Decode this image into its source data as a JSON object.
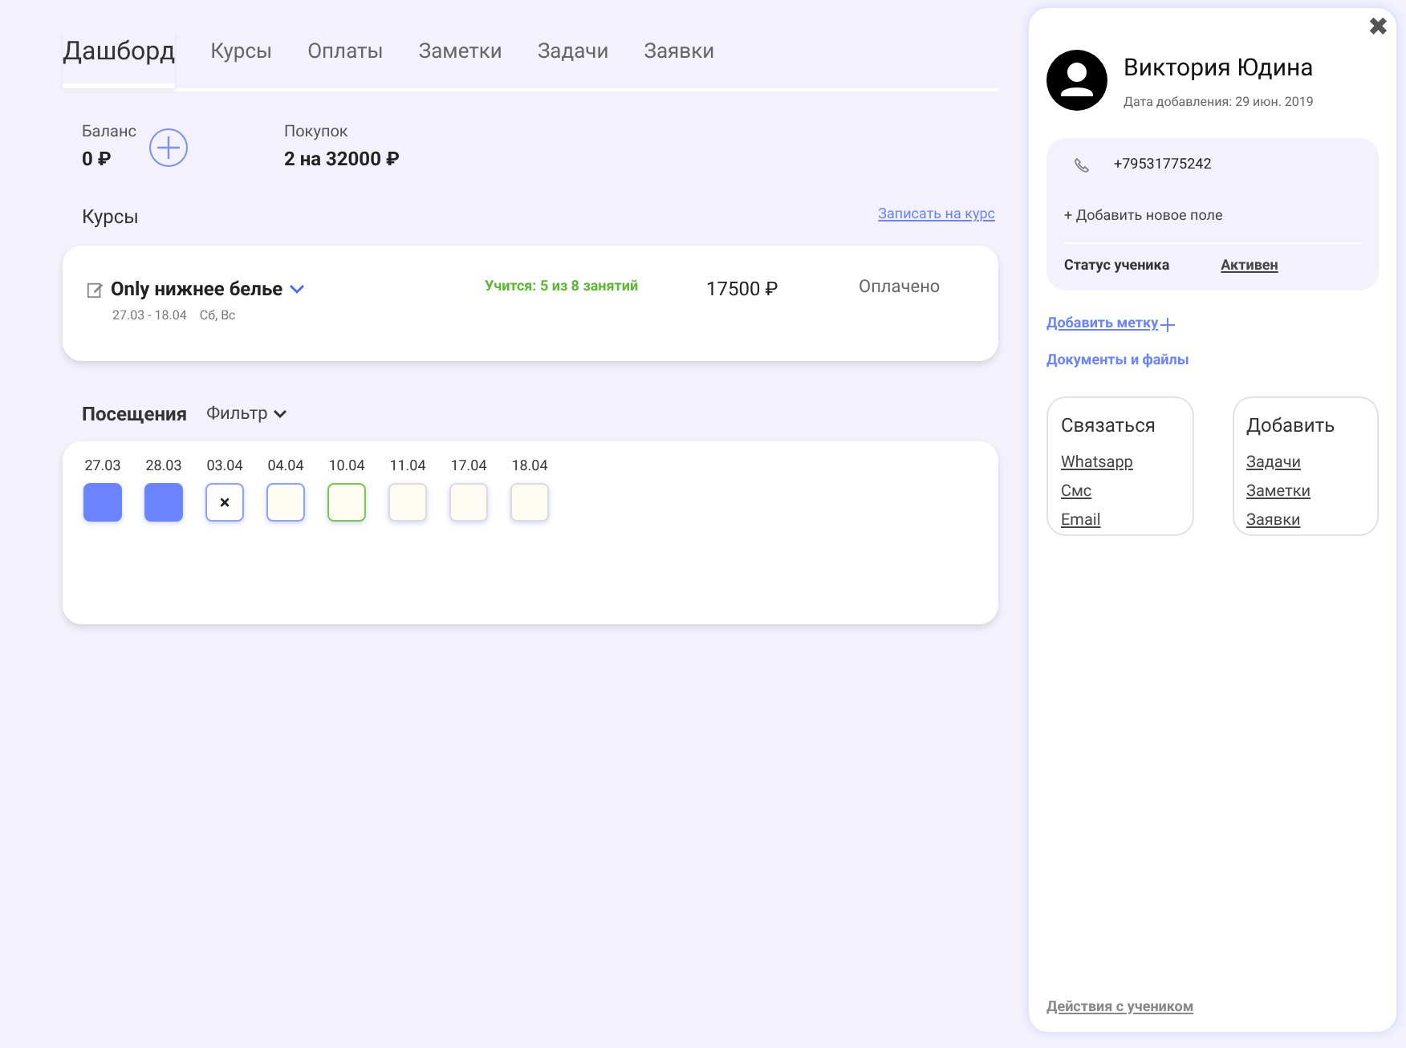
{
  "tabs": [
    {
      "label": "Дашборд",
      "selected": true
    },
    {
      "label": "Курсы",
      "selected": false
    },
    {
      "label": "Оплаты",
      "selected": false
    },
    {
      "label": "Заметки",
      "selected": false
    },
    {
      "label": "Задачи",
      "selected": false
    },
    {
      "label": "Заявки",
      "selected": false
    }
  ],
  "summary": {
    "balance_label": "Баланс",
    "balance": "0 ₽",
    "purchases_label": "Покупок",
    "purchases": "2 на 32000 ₽"
  },
  "courses": {
    "title": "Курсы",
    "enroll_link": "Записать на курс",
    "items": [
      {
        "name": "Only нижнее белье",
        "dates": "27.03 - 18.04",
        "days": "Сб, Вс",
        "progress": "Учится: 5 из 8 занятий",
        "price": "17500 ₽",
        "payment": "Оплачено"
      }
    ]
  },
  "visits": {
    "title": "Посещения",
    "filter": "Фильтр",
    "days": [
      {
        "date": "27.03",
        "kind": "attended"
      },
      {
        "date": "28.03",
        "kind": "attended"
      },
      {
        "date": "03.04",
        "kind": "missed",
        "mark": "×"
      },
      {
        "date": "04.04",
        "kind": "planned"
      },
      {
        "date": "10.04",
        "kind": "current"
      },
      {
        "date": "11.04",
        "kind": "future"
      },
      {
        "date": "17.04",
        "kind": "future"
      },
      {
        "date": "18.04",
        "kind": "future"
      }
    ]
  },
  "profile": {
    "close": "✖",
    "name": "Виктория Юдина",
    "added": "Дата добавления: 29 июн. 2019",
    "phone": "+79531775242",
    "add_field": "+ Добавить новое поле",
    "status_label": "Статус ученика",
    "status": "Активен",
    "add_tag": "Добавить метку",
    "documents": "Документы и файлы",
    "contact": {
      "title": "Связаться",
      "links": [
        "Whatsapp",
        "Смс",
        "Email"
      ]
    },
    "add": {
      "title": "Добавить",
      "links": [
        "Задачи",
        "Заметки",
        "Заявки"
      ]
    },
    "actions": "Действия с учеником"
  }
}
